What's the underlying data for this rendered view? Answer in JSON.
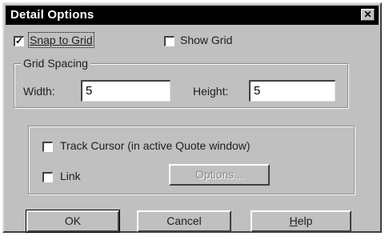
{
  "dialog": {
    "title": "Detail Options",
    "close_glyph": "✕"
  },
  "options": {
    "snap_to_grid": {
      "label": "Snap to Grid",
      "checked": true,
      "check_glyph": "✓"
    },
    "show_grid": {
      "label": "Show Grid",
      "checked": false
    }
  },
  "grid_spacing": {
    "legend": "Grid Spacing",
    "width_label": "Width:",
    "width_value": "5",
    "height_label": "Height:",
    "height_value": "5"
  },
  "tracking": {
    "track_cursor": {
      "label": "Track Cursor (in active Quote window)",
      "checked": false
    },
    "link": {
      "label": "Link",
      "checked": false
    },
    "options_button": "Options..."
  },
  "buttons": {
    "ok": "OK",
    "cancel": "Cancel",
    "help_prefix": "H",
    "help_rest": "elp"
  },
  "colors": {
    "dialog_face": "#c0c0c0",
    "title_bar": "#000000",
    "title_text": "#ffffff"
  }
}
